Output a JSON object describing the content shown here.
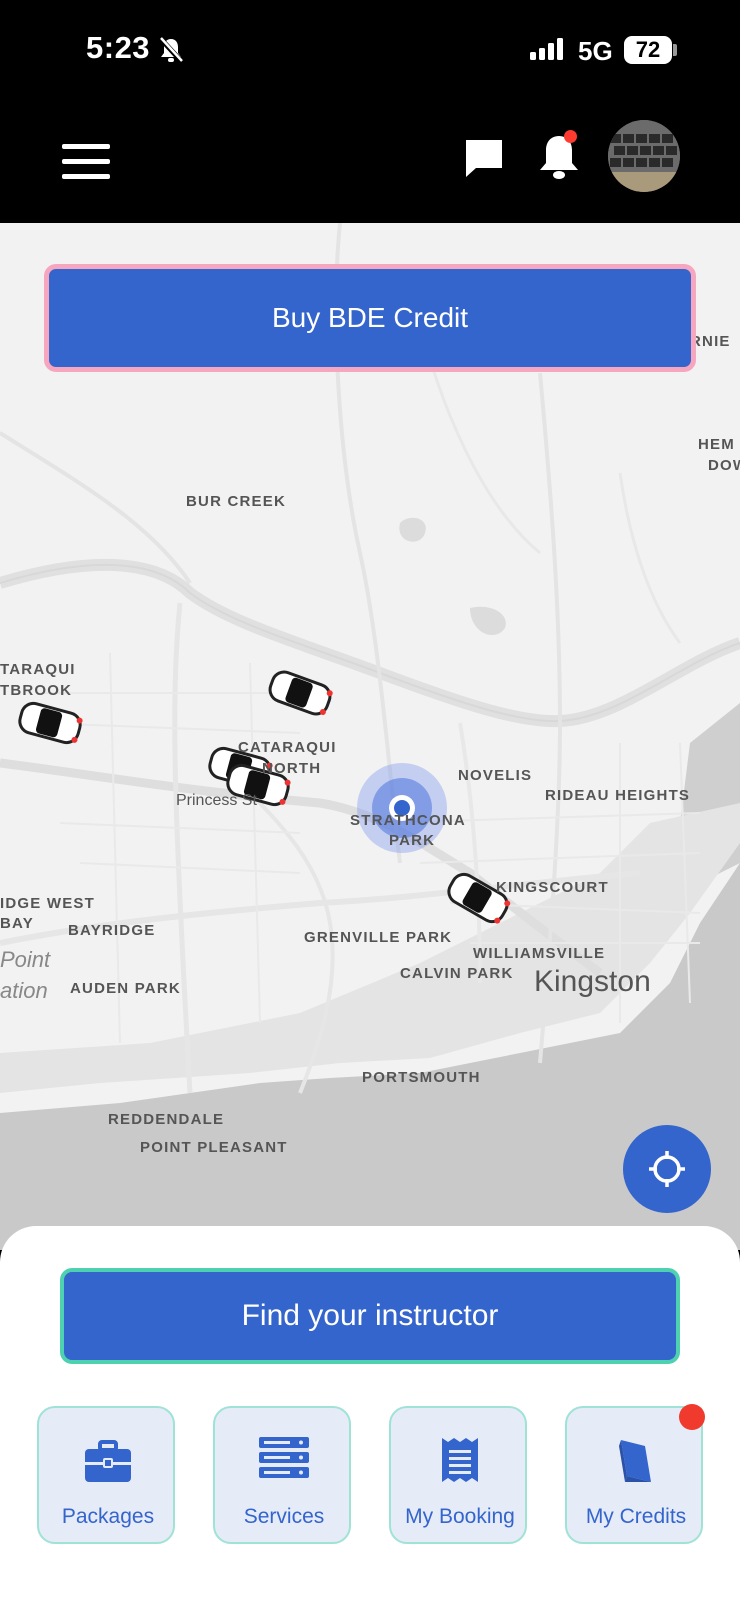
{
  "status_bar": {
    "time": "5:23",
    "network": "5G",
    "battery": "72"
  },
  "header": {
    "menu_icon": "hamburger-menu-icon",
    "chat_icon": "chat-bubble-icon",
    "notification_icon": "bell-icon",
    "has_notification": true,
    "avatar": "profile-avatar"
  },
  "map": {
    "labels": [
      "BUR CREEK",
      "CATARAQUI",
      "NORTH",
      "TARAQUI",
      "TBROOK",
      "Princess St",
      "NOVELIS",
      "RIDEAU HEIGHTS",
      "STRATHCONA",
      "PARK",
      "KINGSCOURT",
      "IDGE WEST",
      "BAY",
      "BAYRIDGE",
      "GRENVILLE PARK",
      "WILLIAMSVILLE",
      "CALVIN PARK",
      "AUDEN PARK",
      "PORTSMOUTH",
      "REDDENDALE",
      "POINT PLEASANT",
      "RNIE",
      "HEM",
      "DOW"
    ],
    "city": "Kingston",
    "italic_labels": [
      "Point",
      "ation"
    ]
  },
  "buy_button": {
    "label": "Buy BDE Credit"
  },
  "locate_button": {
    "icon": "crosshair-locate-icon"
  },
  "find_button": {
    "label": "Find your instructor"
  },
  "tiles": [
    {
      "label": "Packages",
      "icon": "briefcase-icon",
      "badge": false
    },
    {
      "label": "Services",
      "icon": "server-list-icon",
      "badge": false
    },
    {
      "label": "My Booking",
      "icon": "receipt-icon",
      "badge": false
    },
    {
      "label": "My Credits",
      "icon": "book-icon",
      "badge": true
    }
  ],
  "colors": {
    "primary": "#3465cc",
    "accent_border": "#4ed1b0",
    "buy_border": "#f7a6c0",
    "badge": "#ef3a2d"
  }
}
